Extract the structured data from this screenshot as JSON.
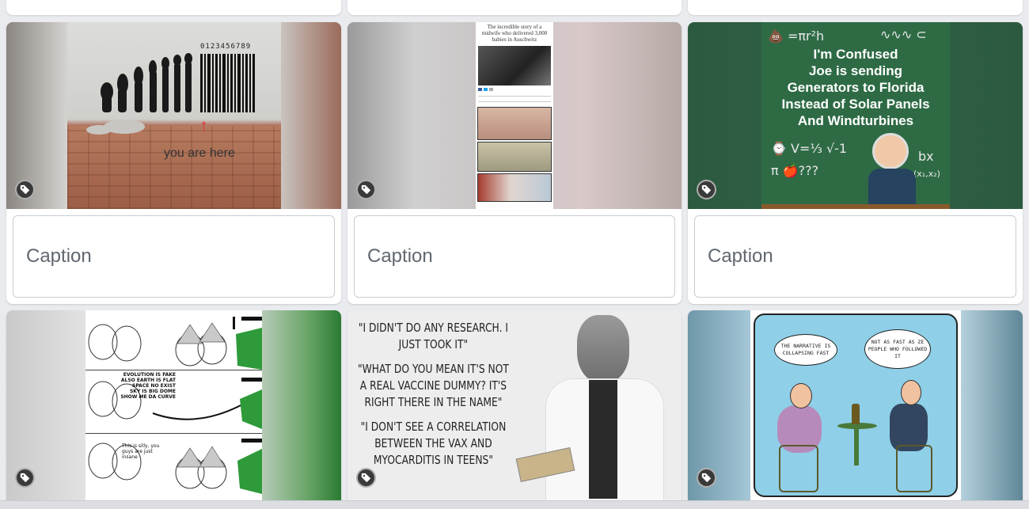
{
  "colors": {
    "background": "#e9ebee",
    "card": "#ffffff",
    "caption_border": "#c9ccd1",
    "tag_badge": "#3a3a3a"
  },
  "icons": {
    "tag": "tag-icon"
  },
  "cards": [
    {
      "caption_placeholder": "Caption",
      "image_text": "you are here",
      "barcode_digits": "0123456789"
    },
    {
      "caption_placeholder": "Caption",
      "image_title": "The incredible story of a midwife who delivered 3,000 babies in Auschwitz"
    },
    {
      "caption_placeholder": "Caption",
      "image_text": "I'm Confused\nJoe is sending\nGenerators to Florida\nInstead of Solar Panels\nAnd Windturbines"
    }
  ],
  "row2": [
    {
      "panel_text_1": "EVOLUTION IS FAKE\nALSO EARTH IS FLAT\nSPACE NO EXIST\nSKY IS BIG DOME\nSHOW ME DA CURVE",
      "panel_text_2": "This is silly, you guys are just insane"
    },
    {
      "quote_1": "\"I DIDN'T DO ANY RESEARCH. I JUST TOOK IT\"",
      "quote_2": "\"WHAT DO YOU MEAN IT'S NOT A REAL VACCINE DUMMY? IT'S RIGHT THERE IN THE NAME\"",
      "quote_3": "\"I DON'T SEE A CORRELATION BETWEEN THE VAX AND MYOCARDITIS IN TEENS\""
    },
    {
      "bubble_1": "THE NARRATIVE IS COLLAPSING FAST",
      "bubble_2": "NOT AS FAST AS ZE PEOPLE WHO FOLLOWED IT"
    }
  ]
}
